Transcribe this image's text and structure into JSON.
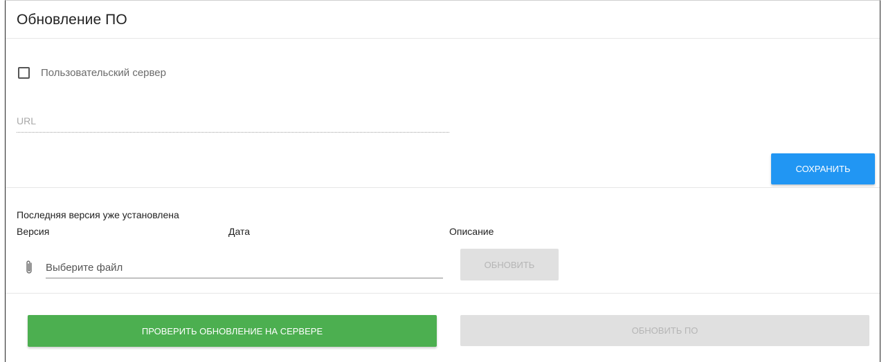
{
  "header": {
    "title": "Обновление ПО"
  },
  "custom_server": {
    "label": "Пользовательский сервер",
    "checked": false
  },
  "url_field": {
    "placeholder": "URL",
    "value": ""
  },
  "buttons": {
    "save": "Сохранить",
    "update": "Обновить",
    "check_server": "Проверить обновление на сервере",
    "update_firmware": "Обновить ПО"
  },
  "status": {
    "text": "Последняя версия уже установлена"
  },
  "table": {
    "columns": [
      "Версия",
      "Дата",
      "Описание"
    ]
  },
  "file_picker": {
    "placeholder": "Выберите файл"
  },
  "colors": {
    "primary": "#2196f3",
    "success": "#4caf50",
    "disabled": "#e0e0e0"
  }
}
